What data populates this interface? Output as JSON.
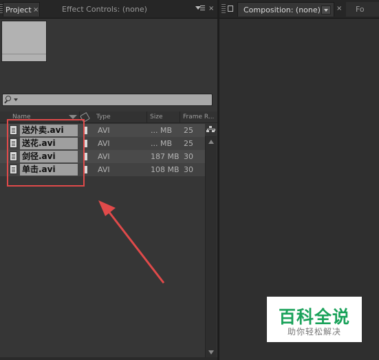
{
  "project_panel": {
    "tab_label": "Project",
    "effect_controls_label": "Effect Controls: (none)",
    "columns": [
      "Name",
      "Type",
      "Size",
      "Frame R..."
    ],
    "files": [
      {
        "name": "送外卖.avi",
        "type": "AVI",
        "size": "... MB",
        "frame_rate": "25"
      },
      {
        "name": "送花.avi",
        "type": "AVI",
        "size": "... MB",
        "frame_rate": "25"
      },
      {
        "name": "剑径.avi",
        "type": "AVI",
        "size": "187 MB",
        "frame_rate": "30"
      },
      {
        "name": "单击.avi",
        "type": "AVI",
        "size": "108 MB",
        "frame_rate": "30"
      }
    ]
  },
  "comp_panel": {
    "tab_label": "Composition: (none)",
    "next_tab_label": "Fo"
  },
  "watermark": {
    "title": "百科全说",
    "subtitle": "助你轻松解决"
  },
  "icons": [
    "search-icon",
    "file-icon",
    "sort-icon",
    "tag-icon",
    "flowchart-icon",
    "lock-icon",
    "close-icon"
  ],
  "colors": {
    "highlight": "#e04a4a",
    "watermark_green": "#1aa25a"
  }
}
